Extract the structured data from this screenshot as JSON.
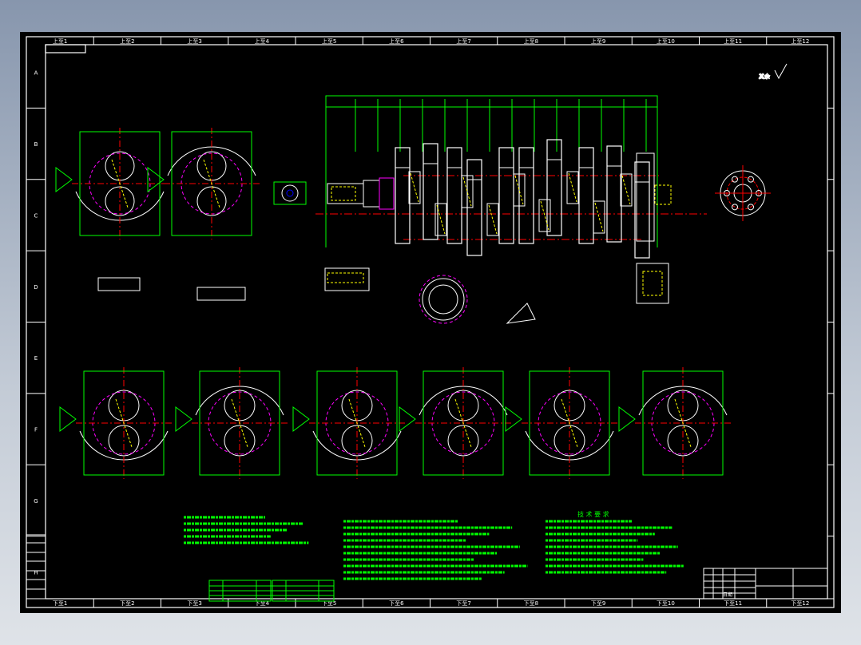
{
  "border": {
    "top_zones": [
      "上至1",
      "上至2",
      "上至3",
      "上至4",
      "上至5",
      "上至6",
      "上至7",
      "上至8",
      "上至9",
      "上至10",
      "上至11",
      "上至12"
    ],
    "bottom_zones": [
      "下至1",
      "下至2",
      "下至3",
      "下至4",
      "下至5",
      "下至6",
      "下至7",
      "下至8",
      "下至9",
      "下至10",
      "下至11",
      "下至12"
    ],
    "rows": [
      "A",
      "B",
      "C",
      "D",
      "E",
      "F",
      "G",
      "H"
    ]
  },
  "notes": {
    "tech_requirements_title": "技 术 要 求",
    "roughness_symbol": "其余"
  },
  "title_block": {
    "date_label": "日期"
  },
  "colors": {
    "background": "#000000",
    "frame": "#ffffff",
    "dimension": "#00ff00",
    "centerline": "#ff0000",
    "hidden": "#ffff00",
    "annotation": "#0000ff",
    "accent": "#ff00ff"
  }
}
